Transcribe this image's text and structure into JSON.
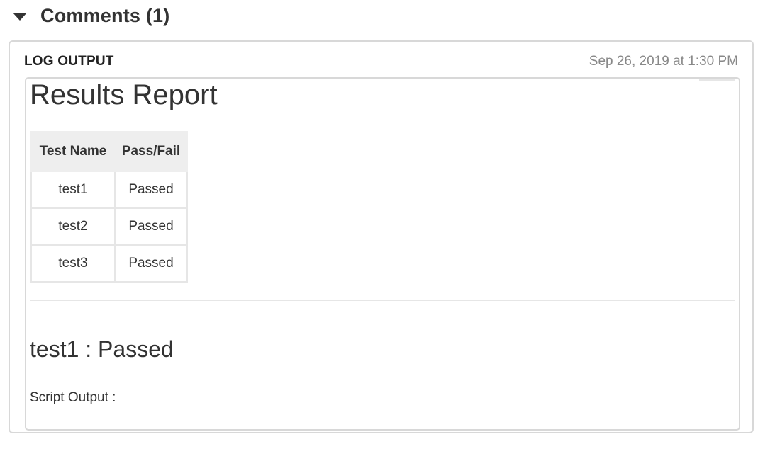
{
  "section": {
    "title": "Comments (1)",
    "collapse_icon": "caret-down-icon"
  },
  "comment": {
    "label": "LOG OUTPUT",
    "timestamp": "Sep 26, 2019 at 1:30 PM"
  },
  "report": {
    "title": "Results Report",
    "table": {
      "headers": [
        "Test Name",
        "Pass/Fail"
      ],
      "rows": [
        {
          "name": "test1",
          "status": "Passed"
        },
        {
          "name": "test2",
          "status": "Passed"
        },
        {
          "name": "test3",
          "status": "Passed"
        }
      ]
    },
    "detail_heading": "test1 : Passed",
    "script_output_label": "Script Output :"
  }
}
